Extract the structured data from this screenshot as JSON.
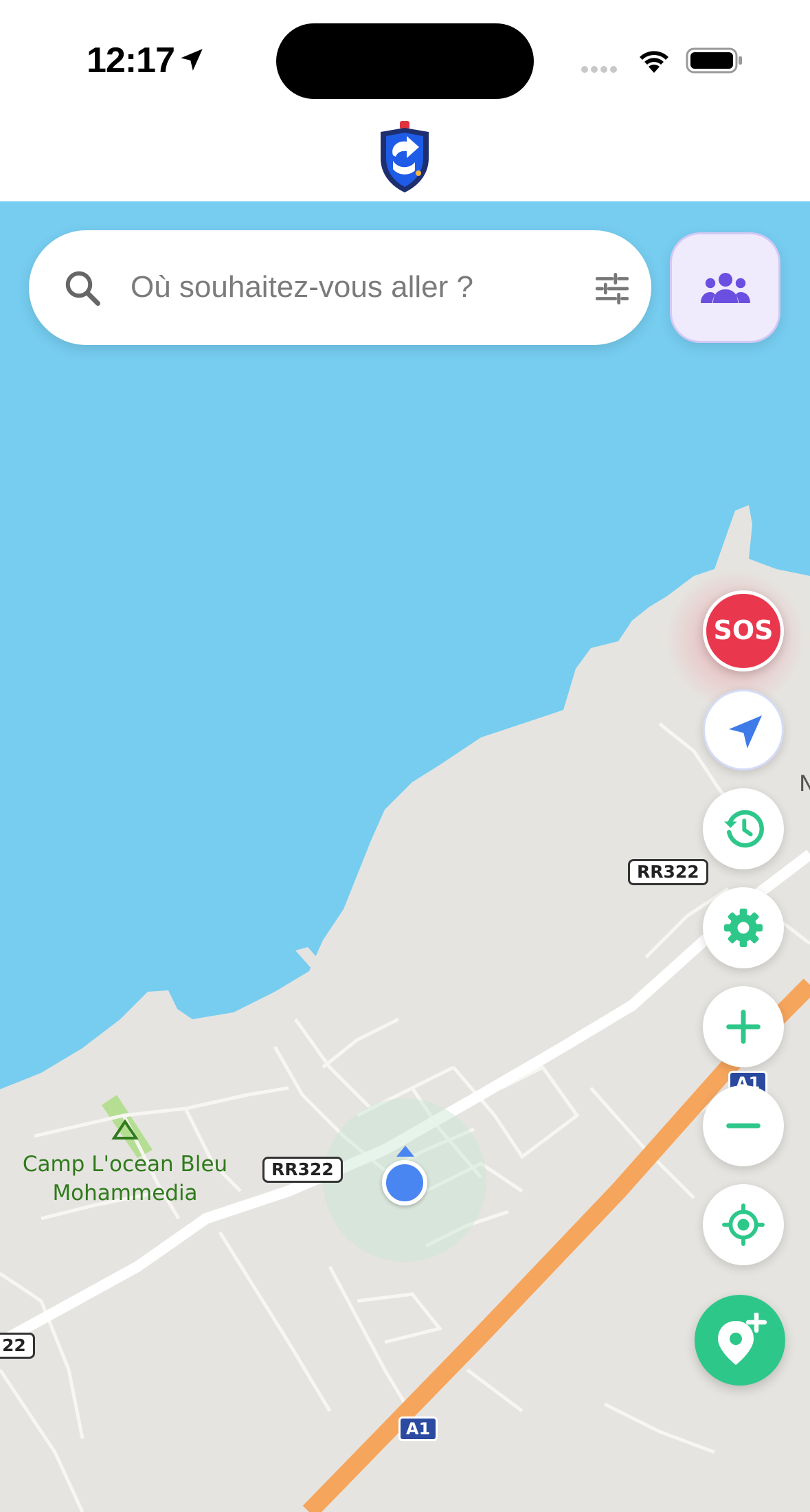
{
  "status_bar": {
    "time": "12:17",
    "icons": [
      "location-arrow-icon",
      "signal-icon",
      "wifi-icon",
      "battery-icon"
    ]
  },
  "header": {
    "logo": "shield-arrow-logo"
  },
  "search": {
    "placeholder": "Où souhaitez-vous aller ?",
    "value": ""
  },
  "buttons": {
    "group": "group-icon",
    "sos_label": "SOS",
    "recenter": "navigation-arrow-icon",
    "history": "history-icon",
    "settings": "gear-icon",
    "zoom_in": "plus-icon",
    "zoom_out": "minus-icon",
    "locate": "crosshair-icon",
    "add_place": "add-location-icon"
  },
  "map": {
    "labels": {
      "rr322_a": "RR322",
      "rr322_b": "RR322",
      "rr322_edge": "22",
      "a1_a": "A1",
      "a1_b": "A1",
      "poi_line1": "Camp L'ocean Bleu",
      "poi_line2": "Mohammedia",
      "edge_letter": "N"
    }
  },
  "colors": {
    "water": "#76cdf0",
    "land": "#e6e4e0",
    "highway": "#f6a55c",
    "accent_green": "#2ec78a",
    "sos_red": "#e9384e",
    "user_blue": "#4a86f2",
    "group_purple": "#6a4fe0"
  }
}
